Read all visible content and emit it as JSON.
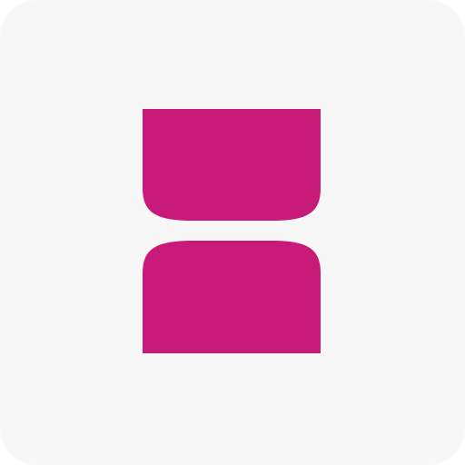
{
  "icon": {
    "name": "app-logo",
    "colors": {
      "background": "#f7f7f7",
      "brand": "#c81a78"
    }
  }
}
